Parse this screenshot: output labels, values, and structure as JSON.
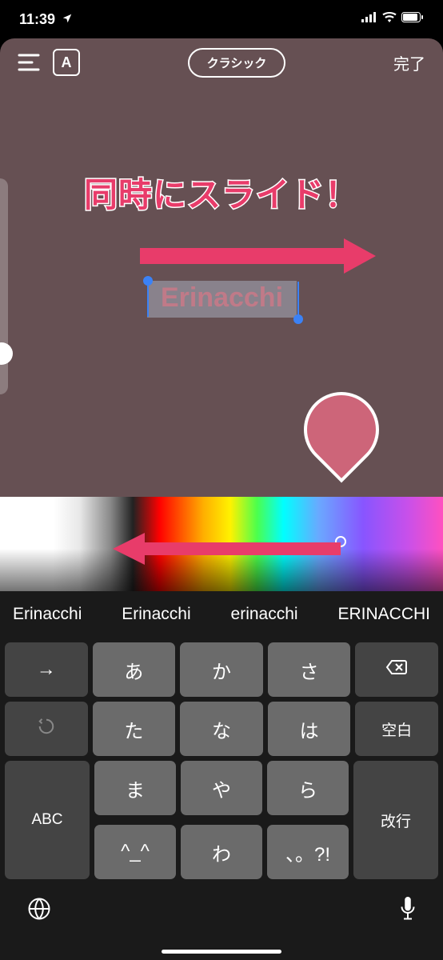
{
  "status": {
    "time": "11:39"
  },
  "toolbar": {
    "letter": "A",
    "style_label": "クラシック",
    "done": "完了"
  },
  "annotation": {
    "headline": "同時にスライド！"
  },
  "editor": {
    "text": "Erinacchi"
  },
  "suggestions": [
    "Erinacchi",
    "Erinacchi",
    "erinacchi",
    "ERINACCHI"
  ],
  "keyboard": {
    "row1": [
      "→",
      "あ",
      "か",
      "さ",
      "⌫"
    ],
    "row2": [
      "↺",
      "た",
      "な",
      "は",
      "空白"
    ],
    "row3_left": "ABC",
    "row3_center": [
      "ま",
      "や",
      "ら"
    ],
    "row3_right": "改行",
    "row4_center": [
      "^_^",
      "わ",
      "、。?!"
    ]
  }
}
